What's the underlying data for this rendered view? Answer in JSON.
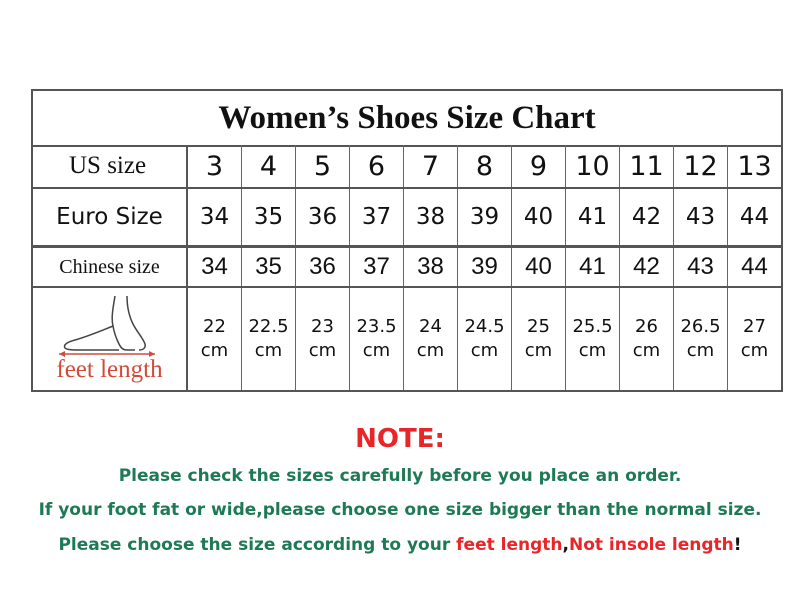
{
  "title": "Women’s Shoes Size Chart",
  "rows": {
    "us": {
      "label": "US size",
      "values": [
        "3",
        "4",
        "5",
        "6",
        "7",
        "8",
        "9",
        "10",
        "11",
        "12",
        "13"
      ]
    },
    "euro": {
      "label": "Euro Size",
      "values": [
        "34",
        "35",
        "36",
        "37",
        "38",
        "39",
        "40",
        "41",
        "42",
        "43",
        "44"
      ]
    },
    "chinese": {
      "label": "Chinese size",
      "values": [
        "34",
        "35",
        "36",
        "37",
        "38",
        "39",
        "40",
        "41",
        "42",
        "43",
        "44"
      ]
    },
    "feet": {
      "label": "feet length",
      "values": [
        "22",
        "22.5",
        "23",
        "23.5",
        "24",
        "24.5",
        "25",
        "25.5",
        "26",
        "26.5",
        "27"
      ],
      "unit": "cm"
    }
  },
  "note": {
    "title": "NOTE:",
    "line1": "Please check the sizes carefully before you place an order.",
    "line2": "If your foot fat or wide,please choose one size bigger than the normal size.",
    "line3_prefix": "Please choose the size according to your ",
    "line3_red1": "feet length",
    "line3_comma": ",",
    "line3_red2": "Not insole length",
    "line3_end": "!"
  },
  "colors": {
    "red": "#e8262a",
    "green": "#1e7a55",
    "border": "#555555"
  }
}
